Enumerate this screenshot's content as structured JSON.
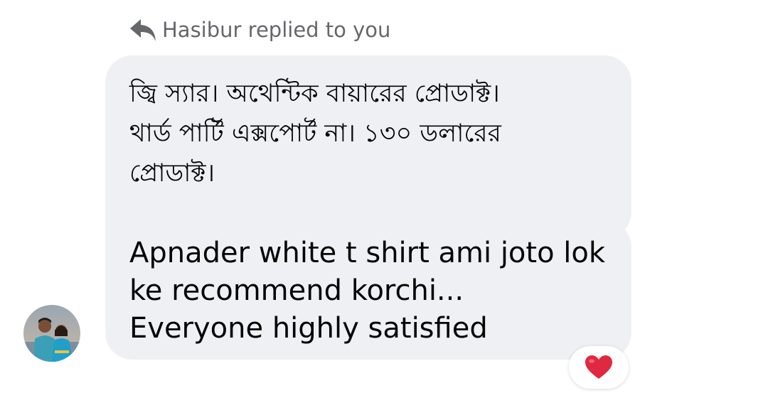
{
  "reply_header": {
    "text": "Hasibur replied to you",
    "icon": "reply-arrow-icon"
  },
  "messages": [
    {
      "lines": [
        "জ্বি স্যার। অথেন্টিক বায়ারের প্রোডাক্ট।",
        "থার্ড পার্টি এক্সপোর্ট না। ১৩০ ডলারের",
        "প্রোডাক্ট।"
      ]
    },
    {
      "text": "Apnader white t shirt ami joto lok ke recommend korchi...  Everyone highly satisfied"
    }
  ],
  "avatar": {
    "icon": "user-avatar-photo"
  },
  "reaction": {
    "emoji": "heart-icon",
    "color": "#e02840"
  },
  "colors": {
    "bubble_bg": "#eff0f4",
    "header_text": "#65676b",
    "message_text": "#050505"
  }
}
